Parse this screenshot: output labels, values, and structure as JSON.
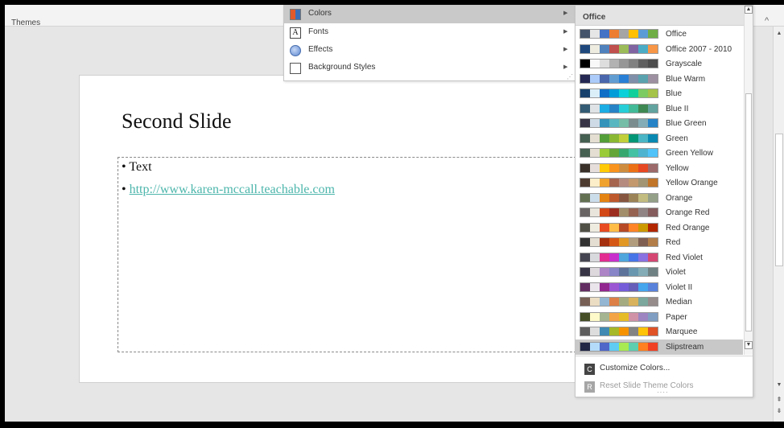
{
  "ribbon": {
    "group_label": "Themes"
  },
  "slide": {
    "title": "Second Slide",
    "bullets": [
      "Text",
      "http://www.karen-mccall.teachable.com"
    ]
  },
  "menu": {
    "items": [
      {
        "label": "Colors",
        "icon": "color-palette-icon"
      },
      {
        "label": "Fonts",
        "icon": "font-icon"
      },
      {
        "label": "Effects",
        "icon": "effects-icon"
      },
      {
        "label": "Background Styles",
        "icon": "background-styles-icon"
      }
    ]
  },
  "palette": {
    "header": "Office",
    "selected": "Slipstream",
    "schemes": [
      {
        "name": "Office",
        "colors": [
          "#44546A",
          "#E7E6E6",
          "#4472C4",
          "#ED7D31",
          "#A5A5A5",
          "#FFC000",
          "#5B9BD5",
          "#70AD47"
        ]
      },
      {
        "name": "Office 2007 - 2010",
        "colors": [
          "#1F497D",
          "#EEECE1",
          "#4F81BD",
          "#C0504D",
          "#9BBB59",
          "#8064A2",
          "#4BACC6",
          "#F79646"
        ]
      },
      {
        "name": "Grayscale",
        "colors": [
          "#000000",
          "#F8F8F8",
          "#DDDDDD",
          "#B2B2B2",
          "#969696",
          "#808080",
          "#5F5F5F",
          "#4D4D4D"
        ]
      },
      {
        "name": "Blue Warm",
        "colors": [
          "#242852",
          "#ACCBF9",
          "#4A66AC",
          "#629DD1",
          "#297FD5",
          "#7F8FA9",
          "#5AA2AE",
          "#9D90A0"
        ]
      },
      {
        "name": "Blue",
        "colors": [
          "#17406D",
          "#DBEFF9",
          "#0F6FC6",
          "#009DD9",
          "#0BD0D9",
          "#10CF9B",
          "#7CCA62",
          "#A5C249"
        ]
      },
      {
        "name": "Blue II",
        "colors": [
          "#335B74",
          "#DFE3E5",
          "#1CADE4",
          "#2683C6",
          "#27CED7",
          "#42BA97",
          "#3E8853",
          "#62A39F"
        ]
      },
      {
        "name": "Blue Green",
        "colors": [
          "#373545",
          "#CEDBE6",
          "#3494BA",
          "#58B6C0",
          "#75BDA7",
          "#7A8C8E",
          "#84ACB6",
          "#2683C6"
        ]
      },
      {
        "name": "Green",
        "colors": [
          "#455F51",
          "#E3DED1",
          "#549E39",
          "#8AB833",
          "#C0CF3A",
          "#029676",
          "#4AB5C4",
          "#0989B1"
        ]
      },
      {
        "name": "Green Yellow",
        "colors": [
          "#455F51",
          "#E3DED1",
          "#99CB38",
          "#63A537",
          "#37A76F",
          "#44C1A3",
          "#4EB3CF",
          "#51C3F9"
        ]
      },
      {
        "name": "Yellow",
        "colors": [
          "#39302A",
          "#E5DEDB",
          "#FFCA08",
          "#F8931D",
          "#CE8D3E",
          "#EC7016",
          "#E64823",
          "#9C6A6A"
        ]
      },
      {
        "name": "Yellow Orange",
        "colors": [
          "#4E3B30",
          "#FBEEC9",
          "#F0A22E",
          "#A5644E",
          "#B58B80",
          "#C3986D",
          "#A19574",
          "#C17529"
        ]
      },
      {
        "name": "Orange",
        "colors": [
          "#637052",
          "#CCDDEA",
          "#E48312",
          "#BD582C",
          "#865640",
          "#9B8357",
          "#C2BC80",
          "#94A088"
        ]
      },
      {
        "name": "Orange Red",
        "colors": [
          "#696464",
          "#E9E5DC",
          "#D34817",
          "#9B2D1F",
          "#A28E6A",
          "#956251",
          "#918485",
          "#855D5D"
        ]
      },
      {
        "name": "Red Orange",
        "colors": [
          "#505046",
          "#EEECE1",
          "#E84C22",
          "#FFBD47",
          "#B64926",
          "#FF8427",
          "#CC9900",
          "#B22600"
        ]
      },
      {
        "name": "Red",
        "colors": [
          "#323232",
          "#E3DED1",
          "#A5300F",
          "#D55816",
          "#E19825",
          "#B19C7D",
          "#7F5F52",
          "#B27D49"
        ]
      },
      {
        "name": "Red Violet",
        "colors": [
          "#454551",
          "#D8D9DC",
          "#E32D91",
          "#C830CC",
          "#4EA6DC",
          "#4775E7",
          "#8971E1",
          "#D54773"
        ]
      },
      {
        "name": "Violet",
        "colors": [
          "#373545",
          "#DCD8DC",
          "#AD84C6",
          "#8784C7",
          "#5D739A",
          "#6997AF",
          "#84ACB6",
          "#6F8183"
        ]
      },
      {
        "name": "Violet II",
        "colors": [
          "#632E62",
          "#EAE5EB",
          "#92278F",
          "#9B57D3",
          "#755DD9",
          "#665EB8",
          "#45A5ED",
          "#5982DB"
        ]
      },
      {
        "name": "Median",
        "colors": [
          "#775F55",
          "#EBDDC3",
          "#94B6D2",
          "#DD8047",
          "#A5AB81",
          "#D8B25C",
          "#7BA79D",
          "#968C8C"
        ]
      },
      {
        "name": "Paper",
        "colors": [
          "#444D26",
          "#FEFAC9",
          "#A5B592",
          "#F3A447",
          "#E7BC29",
          "#D092A7",
          "#9C85C0",
          "#809EC2"
        ]
      },
      {
        "name": "Marquee",
        "colors": [
          "#5E5E5E",
          "#DDDDDD",
          "#418AB3",
          "#A6B727",
          "#F69200",
          "#838383",
          "#FEC306",
          "#DF5327"
        ]
      },
      {
        "name": "Slipstream",
        "colors": [
          "#212745",
          "#B4DCFA",
          "#4E67C8",
          "#5ECCF3",
          "#A7EA52",
          "#5DCEAF",
          "#FF8021",
          "#F14124"
        ]
      }
    ],
    "commands": [
      {
        "label": "Customize Colors...",
        "icon_letter": "C"
      },
      {
        "label": "Reset Slide Theme Colors",
        "icon_letter": "R"
      }
    ]
  }
}
